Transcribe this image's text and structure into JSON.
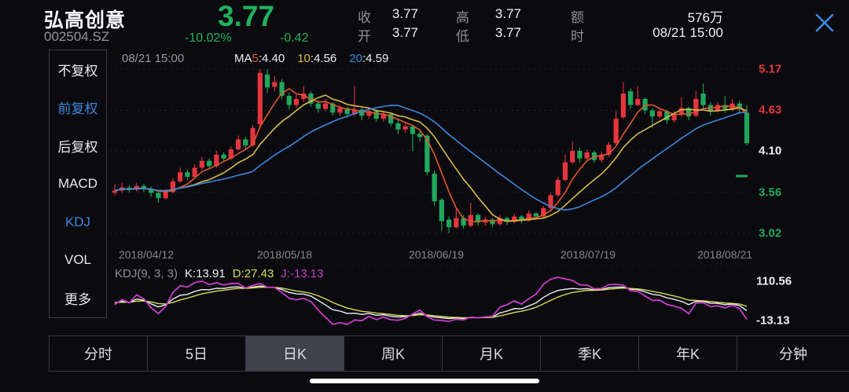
{
  "colors": {
    "up_red": "#e4353f",
    "down_green": "#1fa85c",
    "text_green": "#20b15c",
    "accent_blue": "#3c87e0",
    "ma5": "#e0572e",
    "ma10": "#d9bb4a",
    "ma20": "#3c87e0",
    "kdj_k": "#eef0f2",
    "kdj_d": "#d6dc55",
    "kdj_j": "#cb3bce",
    "axis_white": "#eef0f3",
    "label_gray": "#8e9097"
  },
  "header": {
    "stock_name": "弘高创意",
    "stock_code": "002504.SZ",
    "price": "3.77",
    "change_percent": "-10.02%",
    "change_amount": "-0.42",
    "stats": [
      {
        "label": "收",
        "value": "3.77"
      },
      {
        "label": "开",
        "value": "3.77"
      },
      {
        "label": "高",
        "value": "3.77"
      },
      {
        "label": "低",
        "value": "3.77"
      },
      {
        "label": "额",
        "value": "576万"
      },
      {
        "label": "时",
        "value": "08/21 15:00"
      }
    ]
  },
  "sidebar": {
    "items": [
      {
        "label": "不复权",
        "active": false
      },
      {
        "label": "前复权",
        "active": true
      },
      {
        "label": "后复权",
        "active": false
      },
      {
        "label": "MACD",
        "active": false
      },
      {
        "label": "KDJ",
        "active": true
      },
      {
        "label": "VOL",
        "active": false
      },
      {
        "label": "更多",
        "active": false
      }
    ]
  },
  "chart": {
    "datetime_label": "08/21 15:00"
  },
  "chart_data": {
    "type": "candlestick",
    "title": "弘高创意 002504.SZ 日K 前复权",
    "x_axis_labels": [
      "2018/04/12",
      "2018/05/18",
      "2018/06/19",
      "2018/07/19",
      "2018/08/21"
    ],
    "y_axis_labels": [
      {
        "text": "5.17",
        "value": 5.17,
        "color": "#e4353f"
      },
      {
        "text": "4.63",
        "value": 4.63,
        "color": "#e4353f"
      },
      {
        "text": "4.10",
        "value": 4.1,
        "color": "#eef0f3"
      },
      {
        "text": "3.56",
        "value": 3.56,
        "color": "#1fa85c"
      },
      {
        "text": "3.02",
        "value": 3.02,
        "color": "#1fa85c"
      }
    ],
    "y_range": [
      3.02,
      5.17
    ],
    "last_price": 3.77,
    "ma_lines": [
      {
        "prefix": "MA",
        "period": "5",
        "value": "4.40",
        "color": "#e0572e",
        "window": 5
      },
      {
        "prefix": "",
        "period": "10",
        "value": "4.56",
        "color": "#d9bb4a",
        "window": 10
      },
      {
        "prefix": "",
        "period": "20",
        "value": "4.59",
        "color": "#3c87e0",
        "window": 20
      }
    ],
    "candles": [
      [
        3.55,
        3.66,
        3.52,
        3.58
      ],
      [
        3.58,
        3.68,
        3.55,
        3.62
      ],
      [
        3.62,
        3.65,
        3.55,
        3.59
      ],
      [
        3.59,
        3.68,
        3.57,
        3.64
      ],
      [
        3.64,
        3.67,
        3.56,
        3.6
      ],
      [
        3.6,
        3.63,
        3.5,
        3.55
      ],
      [
        3.55,
        3.58,
        3.42,
        3.48
      ],
      [
        3.48,
        3.6,
        3.46,
        3.56
      ],
      [
        3.56,
        3.74,
        3.54,
        3.7
      ],
      [
        3.7,
        3.88,
        3.68,
        3.82
      ],
      [
        3.82,
        3.85,
        3.72,
        3.76
      ],
      [
        3.76,
        3.92,
        3.74,
        3.88
      ],
      [
        3.88,
        4.02,
        3.85,
        3.97
      ],
      [
        3.97,
        4.0,
        3.86,
        3.9
      ],
      [
        3.9,
        4.1,
        3.88,
        4.05
      ],
      [
        4.05,
        4.08,
        3.95,
        4.0
      ],
      [
        4.0,
        4.16,
        3.98,
        4.12
      ],
      [
        4.12,
        4.3,
        4.1,
        4.25
      ],
      [
        4.25,
        4.28,
        4.12,
        4.17
      ],
      [
        4.17,
        4.44,
        4.15,
        4.4
      ],
      [
        4.45,
        5.17,
        4.4,
        5.12
      ],
      [
        5.1,
        5.17,
        4.86,
        4.93
      ],
      [
        4.94,
        5.08,
        4.88,
        5.0
      ],
      [
        5.0,
        5.04,
        4.78,
        4.82
      ],
      [
        4.82,
        4.86,
        4.64,
        4.7
      ],
      [
        4.7,
        4.84,
        4.66,
        4.78
      ],
      [
        4.78,
        4.95,
        4.74,
        4.85
      ],
      [
        4.85,
        4.88,
        4.68,
        4.72
      ],
      [
        4.72,
        4.76,
        4.6,
        4.65
      ],
      [
        4.65,
        4.78,
        4.62,
        4.72
      ],
      [
        4.72,
        4.74,
        4.56,
        4.6
      ],
      [
        4.6,
        4.7,
        4.56,
        4.66
      ],
      [
        4.66,
        4.68,
        4.54,
        4.58
      ],
      [
        4.58,
        4.95,
        4.56,
        4.64
      ],
      [
        4.64,
        4.66,
        4.5,
        4.56
      ],
      [
        4.56,
        4.66,
        4.52,
        4.62
      ],
      [
        4.62,
        4.64,
        4.48,
        4.52
      ],
      [
        4.52,
        4.62,
        4.48,
        4.58
      ],
      [
        4.58,
        4.6,
        4.42,
        4.46
      ],
      [
        4.46,
        4.5,
        4.32,
        4.38
      ],
      [
        4.38,
        4.46,
        4.34,
        4.42
      ],
      [
        4.42,
        4.44,
        4.1,
        4.32
      ],
      [
        4.32,
        4.38,
        4.22,
        4.28
      ],
      [
        4.3,
        4.32,
        3.78,
        3.82
      ],
      [
        3.8,
        3.84,
        3.38,
        3.44
      ],
      [
        3.46,
        3.48,
        3.05,
        3.18
      ],
      [
        3.2,
        3.24,
        3.02,
        3.1
      ],
      [
        3.1,
        3.35,
        3.08,
        3.22
      ],
      [
        3.22,
        3.26,
        3.08,
        3.12
      ],
      [
        3.12,
        3.42,
        3.1,
        3.26
      ],
      [
        3.26,
        3.28,
        3.12,
        3.16
      ],
      [
        3.16,
        3.24,
        3.12,
        3.2
      ],
      [
        3.2,
        3.22,
        3.1,
        3.14
      ],
      [
        3.14,
        3.26,
        3.12,
        3.22
      ],
      [
        3.22,
        3.24,
        3.13,
        3.17
      ],
      [
        3.17,
        3.28,
        3.15,
        3.24
      ],
      [
        3.24,
        3.26,
        3.15,
        3.19
      ],
      [
        3.19,
        3.32,
        3.17,
        3.28
      ],
      [
        3.28,
        3.3,
        3.2,
        3.24
      ],
      [
        3.24,
        3.38,
        3.22,
        3.35
      ],
      [
        3.35,
        3.55,
        3.33,
        3.52
      ],
      [
        3.52,
        3.76,
        3.5,
        3.72
      ],
      [
        3.72,
        4.05,
        3.7,
        3.95
      ],
      [
        3.95,
        4.22,
        3.93,
        4.1
      ],
      [
        4.1,
        4.14,
        3.95,
        4.0
      ],
      [
        4.0,
        4.12,
        3.98,
        4.08
      ],
      [
        4.08,
        4.1,
        3.94,
        3.98
      ],
      [
        3.98,
        4.09,
        3.95,
        4.05
      ],
      [
        4.05,
        4.22,
        4.02,
        4.18
      ],
      [
        4.2,
        4.62,
        4.18,
        4.52
      ],
      [
        4.54,
        5.0,
        4.52,
        4.85
      ],
      [
        4.88,
        4.92,
        4.65,
        4.7
      ],
      [
        4.7,
        4.95,
        4.68,
        4.78
      ],
      [
        4.78,
        4.8,
        4.58,
        4.63
      ],
      [
        4.63,
        4.66,
        4.4,
        4.55
      ],
      [
        4.55,
        4.66,
        4.52,
        4.62
      ],
      [
        4.62,
        4.64,
        4.45,
        4.5
      ],
      [
        4.5,
        4.62,
        4.47,
        4.58
      ],
      [
        4.58,
        4.8,
        4.55,
        4.66
      ],
      [
        4.66,
        4.68,
        4.5,
        4.55
      ],
      [
        4.56,
        4.88,
        4.54,
        4.78
      ],
      [
        4.85,
        4.98,
        4.66,
        4.7
      ],
      [
        4.7,
        4.74,
        4.56,
        4.62
      ],
      [
        4.62,
        4.74,
        4.6,
        4.7
      ],
      [
        4.7,
        4.82,
        4.6,
        4.65
      ],
      [
        4.65,
        4.78,
        4.62,
        4.72
      ],
      [
        4.72,
        4.76,
        4.58,
        4.66
      ],
      [
        4.6,
        4.7,
        4.17,
        4.2
      ]
    ],
    "secondary_indicator": {
      "type": "KDJ",
      "title": "KDJ(9, 3, 3)",
      "k_label": "K:13.91",
      "d_label": "D:27.43",
      "j_label": "J:-13.13",
      "k": 13.91,
      "d": 27.43,
      "j": -13.13,
      "axis_top": "110.56",
      "axis_bottom": "-13.13"
    }
  },
  "tabs": [
    {
      "label": "分时",
      "active": false
    },
    {
      "label": "5日",
      "active": false
    },
    {
      "label": "日K",
      "active": true
    },
    {
      "label": "周K",
      "active": false
    },
    {
      "label": "月K",
      "active": false
    },
    {
      "label": "季K",
      "active": false
    },
    {
      "label": "年K",
      "active": false
    },
    {
      "label": "分钟",
      "active": false,
      "dropdown": true
    }
  ]
}
